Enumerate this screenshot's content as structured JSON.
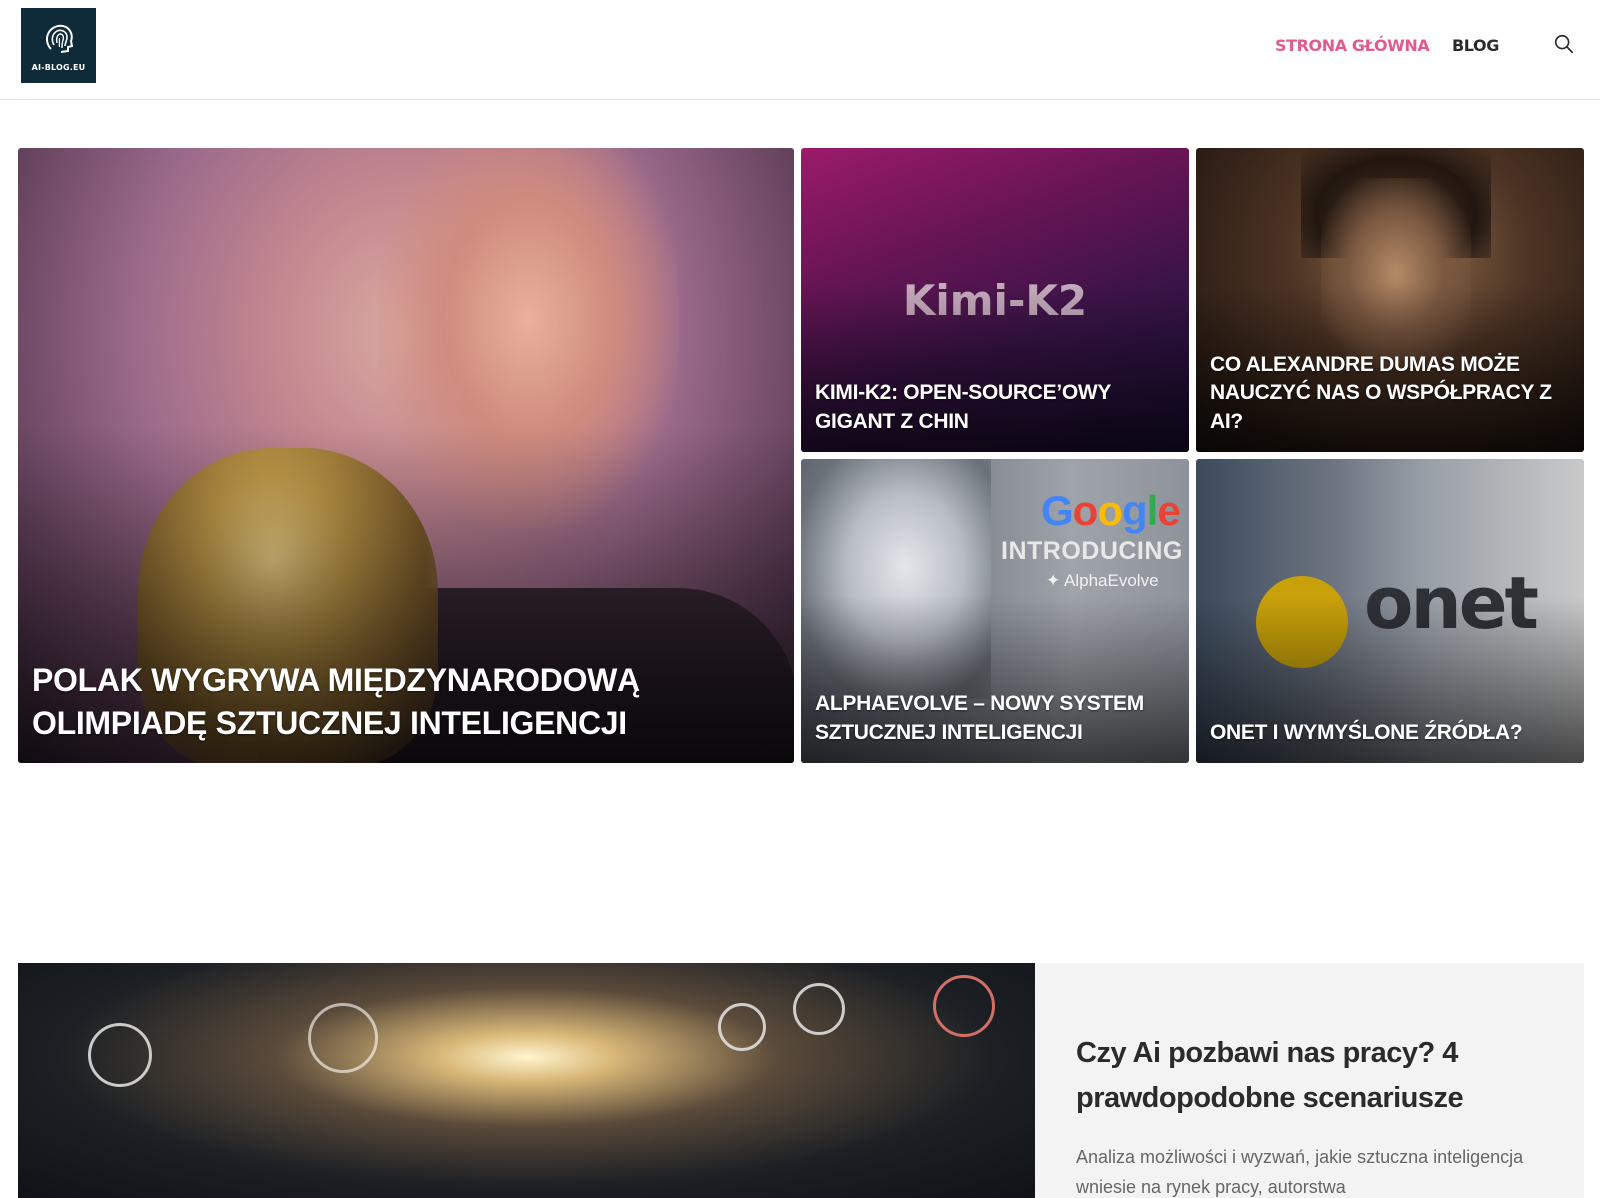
{
  "header": {
    "logo_text": "AI-BLOG.EU",
    "nav": [
      {
        "label": "STRONA GŁÓWNA",
        "active": true,
        "color": "#e25a91"
      },
      {
        "label": "BLOG",
        "active": false,
        "color": "#2a2a2a"
      }
    ],
    "search_icon": "search-icon"
  },
  "featured": {
    "main": {
      "title": "POLAK WYGRYWA MIĘDZYNARODOWĄ OLIMPIADĘ SZTUCZNEJ INTELIGENCJI"
    },
    "cards": [
      {
        "title": "KIMI-K2: OPEN-SOURCE’OWY GIGANT Z CHIN",
        "image_text": "Kimi-K2"
      },
      {
        "title": "CO ALEXANDRE DUMAS MOŻE NAUCZYĆ NAS O WSPÓŁPRACY Z AI?"
      },
      {
        "title": "ALPHAEVOLVE – NOWY SYSTEM SZTUCZNEJ INTELIGENCJI",
        "image_brand": [
          "G",
          "o",
          "o",
          "g",
          "l",
          "e"
        ],
        "image_heading": "INTRODUCING",
        "image_sub": "✦ AlphaEvolve"
      },
      {
        "title": "ONET I WYMYŚLONE ŹRÓDŁA?",
        "image_text": "onet"
      }
    ]
  },
  "section2": {
    "title": "Czy Ai pozbawi nas pracy? 4 prawdopodobne scenariusze",
    "excerpt": "Analiza możliwości i wyzwań, jakie sztuczna inteligencja wniesie na rynek pracy, autorstwa"
  },
  "colors": {
    "accent": "#e25a91",
    "logo_bg": "#0f2a38",
    "panel_bg": "#f3f3f3"
  }
}
